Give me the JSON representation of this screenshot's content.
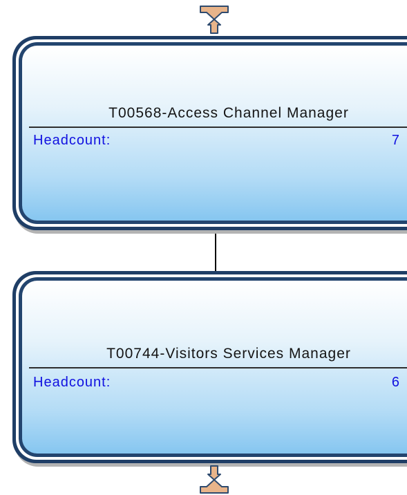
{
  "colors": {
    "node_border": "#1f3e66",
    "node_fill_top": "#ffffff",
    "node_fill_bottom": "#86c6f0",
    "metric_text": "#1010e0",
    "title_text": "#141414",
    "arrow_fill": "#e8b48a",
    "arrow_stroke": "#2e4a6e",
    "connector": "#000000"
  },
  "icons": {
    "top_arrow": "arrow-up-icon",
    "bottom_arrow": "arrow-down-icon"
  },
  "nodes": [
    {
      "title": "T00568-Access Channel Manager",
      "metric_label": "Headcount:",
      "metric_value": "7"
    },
    {
      "title": "T00744-Visitors Services Manager",
      "metric_label": "Headcount:",
      "metric_value": "6"
    }
  ]
}
